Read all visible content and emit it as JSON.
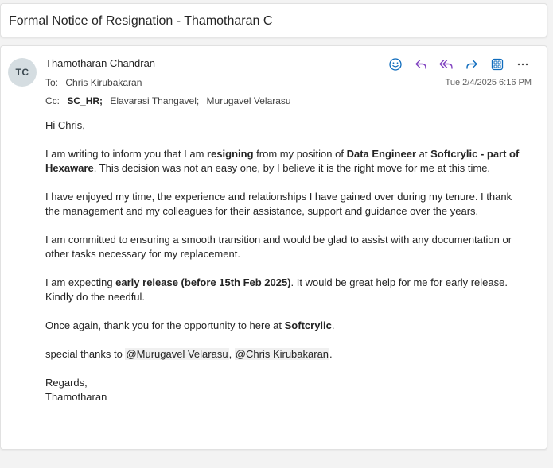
{
  "subject": "Formal Notice of Resignation - Thamotharan C",
  "message": {
    "avatar_initials": "TC",
    "sender": "Thamotharan Chandran",
    "to_label": "To:",
    "to": [
      "Chris Kirubakaran"
    ],
    "cc_label": "Cc:",
    "cc": [
      "SC_HR;",
      "Elavarasi Thangavel;",
      "Murugavel Velarasu"
    ],
    "timestamp": "Tue 2/4/2025 6:16 PM",
    "toolbar_icons": [
      "emoji-icon",
      "reply-icon",
      "reply-all-icon",
      "forward-icon",
      "apps-icon",
      "more-icon"
    ],
    "accent_color": "#7f3fbf",
    "forward_color": "#0f6cbd"
  },
  "body": {
    "greeting": "Hi Chris,",
    "p1": {
      "t1": "I am writing to inform you that I am ",
      "b1": "resigning",
      "t2": " from my position of ",
      "b2": "Data Engineer",
      "t3": " at ",
      "b3": "Softcrylic - part of Hexaware",
      "t4": ". This decision was not an easy one, by I believe it is the right move for me at this time."
    },
    "p2": "I have enjoyed my time, the experience and relationships I have gained over during my tenure. I thank the management and my colleagues for their assistance, support and guidance over the years.",
    "p3": "I am committed to ensuring a smooth transition and would be glad to assist with any documentation or other tasks necessary for my replacement.",
    "p4": {
      "t1": "I am expecting ",
      "b1": "early release (before 15th Feb 2025)",
      "t2": ". It would be great help for me for early release. Kindly do the needful."
    },
    "p5": {
      "t1": "Once again, thank you for the opportunity to here at ",
      "b1": "Softcrylic",
      "t2": "."
    },
    "p6": {
      "t1": "special thanks to ",
      "m1": "@Murugavel Velarasu",
      "t2": ", ",
      "m2": "@Chris Kirubakaran",
      "t3": "."
    },
    "regards": "Regards,",
    "signature": "Thamotharan"
  }
}
